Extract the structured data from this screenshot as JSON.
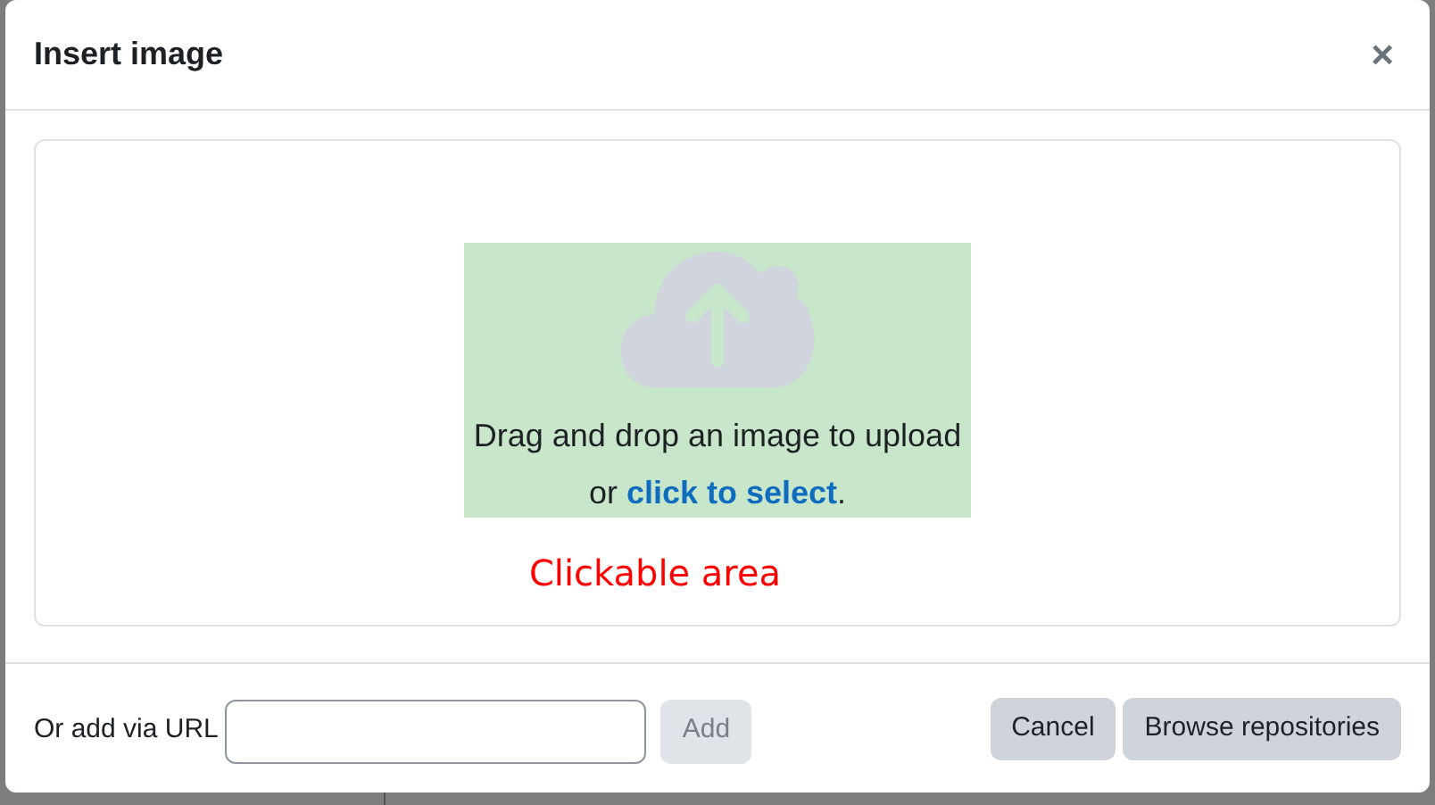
{
  "dialog": {
    "title": "Insert image",
    "close": "×"
  },
  "dropzone": {
    "line_1": "Drag and drop an image to upload",
    "prefix": "or ",
    "link": "click to select",
    "suffix": ".",
    "annotation": "Clickable area"
  },
  "footer": {
    "url_label": "Or add via URL",
    "add_button": {
      "label": "Add",
      "disabled": true
    },
    "buttons": [
      "Cancel",
      "Browse repositories"
    ]
  }
}
